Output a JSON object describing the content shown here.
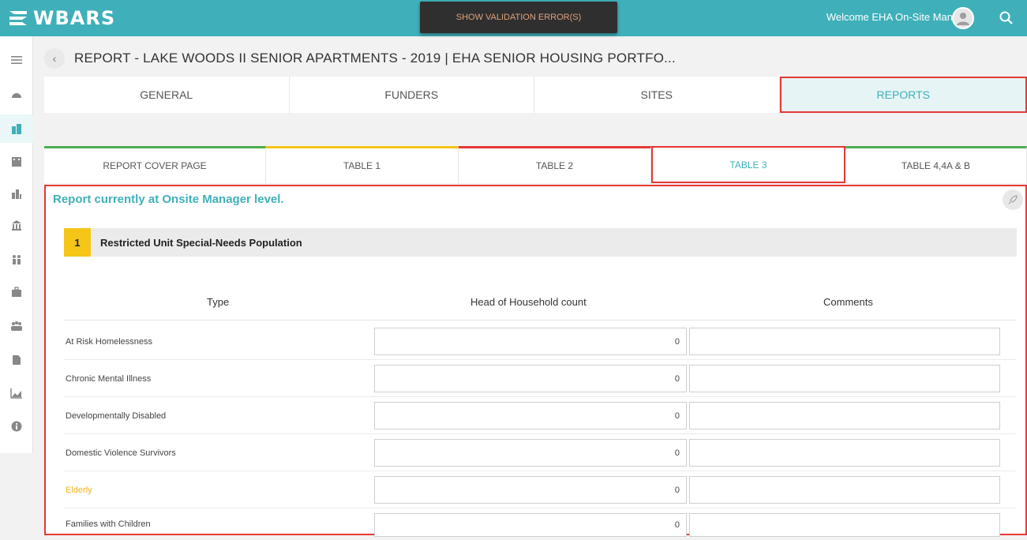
{
  "app": {
    "logo_text": "WBARS",
    "validation_button": "SHOW VALIDATION ERROR(S)",
    "welcome_text": "Welcome EHA On-Site Manager"
  },
  "sidebar": {
    "items": [
      "menu-icon",
      "dashboard-icon",
      "properties-icon",
      "buildings-icon",
      "city-icon",
      "bank-icon",
      "people-icon",
      "briefcase-icon",
      "users-icon",
      "document-icon",
      "chart-icon",
      "info-icon"
    ]
  },
  "page": {
    "back_label": "‹",
    "title": "REPORT - LAKE WOODS II SENIOR APARTMENTS - 2019 | EHA SENIOR HOUSING PORTFO..."
  },
  "main_tabs": [
    {
      "label": "GENERAL"
    },
    {
      "label": "FUNDERS"
    },
    {
      "label": "SITES"
    },
    {
      "label": "REPORTS"
    }
  ],
  "sub_tabs": [
    {
      "label": "REPORT COVER PAGE"
    },
    {
      "label": "TABLE 1"
    },
    {
      "label": "TABLE 2"
    },
    {
      "label": "TABLE 3"
    },
    {
      "label": "TABLE 4,4A & B"
    }
  ],
  "report": {
    "status": "Report currently at Onsite Manager level.",
    "section_number": "1",
    "section_title": "Restricted Unit Special-Needs Population",
    "columns": {
      "type": "Type",
      "count": "Head of Household count",
      "comments": "Comments"
    },
    "rows": [
      {
        "type": "At Risk Homelessness",
        "count": "0",
        "comment": ""
      },
      {
        "type": "Chronic Mental Illness",
        "count": "0",
        "comment": ""
      },
      {
        "type": "Developmentally Disabled",
        "count": "0",
        "comment": ""
      },
      {
        "type": "Domestic Violence Survivors",
        "count": "0",
        "comment": ""
      },
      {
        "type": "Elderly",
        "count": "0",
        "comment": ""
      },
      {
        "type": "Families with Children",
        "count": "0",
        "comment": ""
      }
    ]
  },
  "colors": {
    "brand": "#3fb0ba",
    "warning": "#f0b31b",
    "highlight": "#e53935",
    "complete": "#4caf50"
  }
}
